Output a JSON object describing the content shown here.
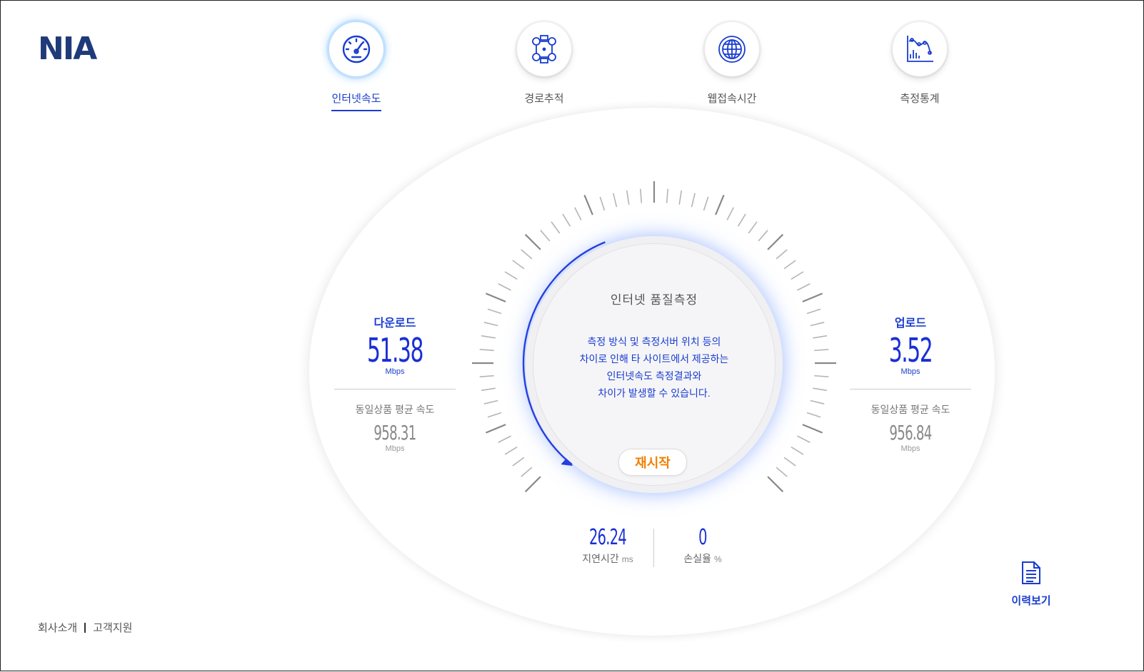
{
  "brand": {
    "logo": "NIA"
  },
  "nav": [
    {
      "label": "인터넷속도",
      "icon": "speedometer-icon",
      "active": true
    },
    {
      "label": "경로추적",
      "icon": "route-trace-icon",
      "active": false
    },
    {
      "label": "웹접속시간",
      "icon": "globe-icon",
      "active": false
    },
    {
      "label": "측정통계",
      "icon": "statistics-chart-icon",
      "active": false
    }
  ],
  "center": {
    "title": "인터넷 품질측정",
    "message": [
      "측정 방식 및 측정서버 위치 등의",
      "차이로 인해 타 사이트에서 제공하는",
      "인터넷속도 측정결과와",
      "차이가 발생할 수 있습니다."
    ],
    "restart_label": "재시작"
  },
  "download": {
    "title": "다운로드",
    "value": "51.38",
    "unit": "Mbps",
    "avg_label": "동일상품 평균 속도",
    "avg_value": "958.31",
    "avg_unit": "Mbps"
  },
  "upload": {
    "title": "업로드",
    "value": "3.52",
    "unit": "Mbps",
    "avg_label": "동일상품 평균 속도",
    "avg_value": "956.84",
    "avg_unit": "Mbps"
  },
  "latency": {
    "value": "26.24",
    "label": "지연시간",
    "unit": "ms"
  },
  "loss": {
    "value": "0",
    "label": "손실율",
    "unit": "%"
  },
  "history": {
    "label": "이력보기",
    "icon": "document-icon"
  },
  "footer": {
    "about": "회사소개",
    "support": "고객지원"
  },
  "colors": {
    "accent": "#1a3ccf",
    "brand": "#1f3a7a",
    "restart": "#f08000"
  }
}
